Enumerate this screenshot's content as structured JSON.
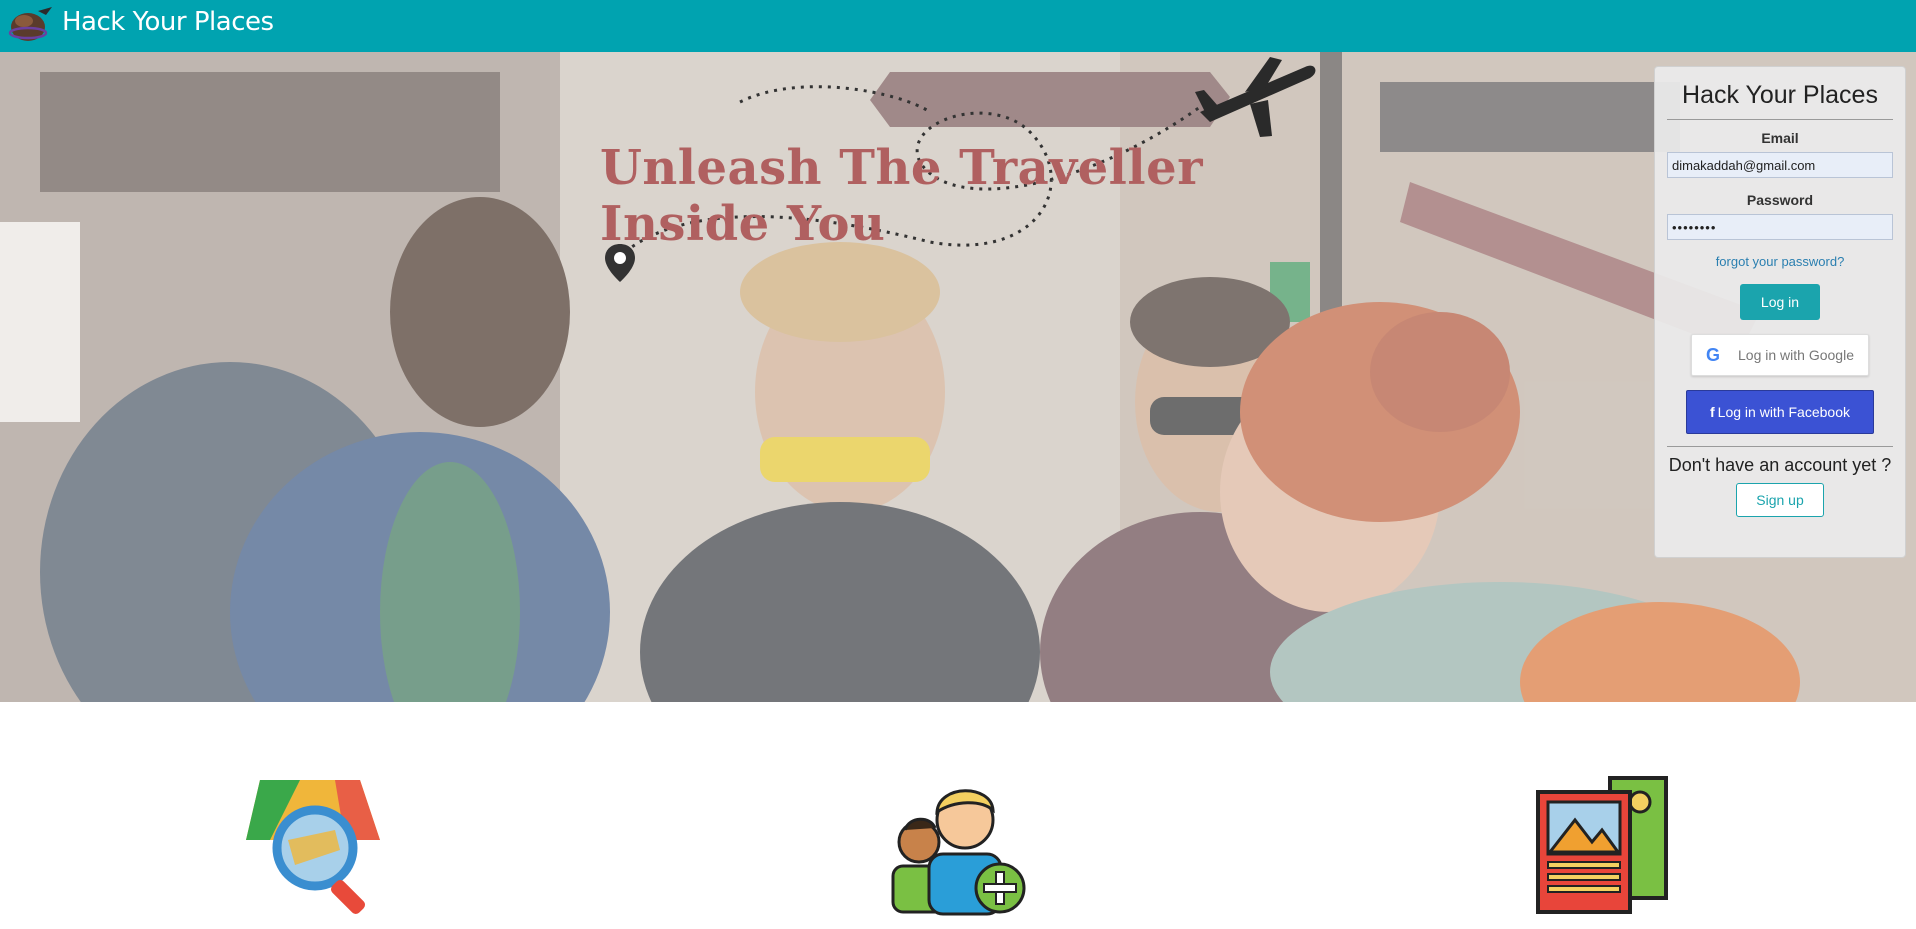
{
  "header": {
    "brand_name": "Hack Your Places",
    "logo_icon": "globe-with-plane-icon",
    "background_color": "#00a3b0"
  },
  "hero": {
    "headline": "Unleash The Traveller Inside You",
    "headline_color": "#b06060",
    "decor_icons": [
      "airplane-icon",
      "location-pin-icon"
    ]
  },
  "login": {
    "title": "Hack Your Places",
    "email_label": "Email",
    "email_value": "dimakaddah@gmail.com",
    "password_label": "Password",
    "password_value": "••••••••",
    "forgot_link": "forgot your password?",
    "login_button": "Log in",
    "google_button": "Log in with Google",
    "facebook_button": "Log in with Facebook",
    "no_account_text": "Don't have an account yet ?",
    "signup_button": "Sign up",
    "accent_color": "#1ba4ad",
    "facebook_color": "#3b52d4"
  },
  "features": {
    "icons": [
      "map-search-icon",
      "add-friend-icon",
      "photo-cards-icon"
    ]
  }
}
